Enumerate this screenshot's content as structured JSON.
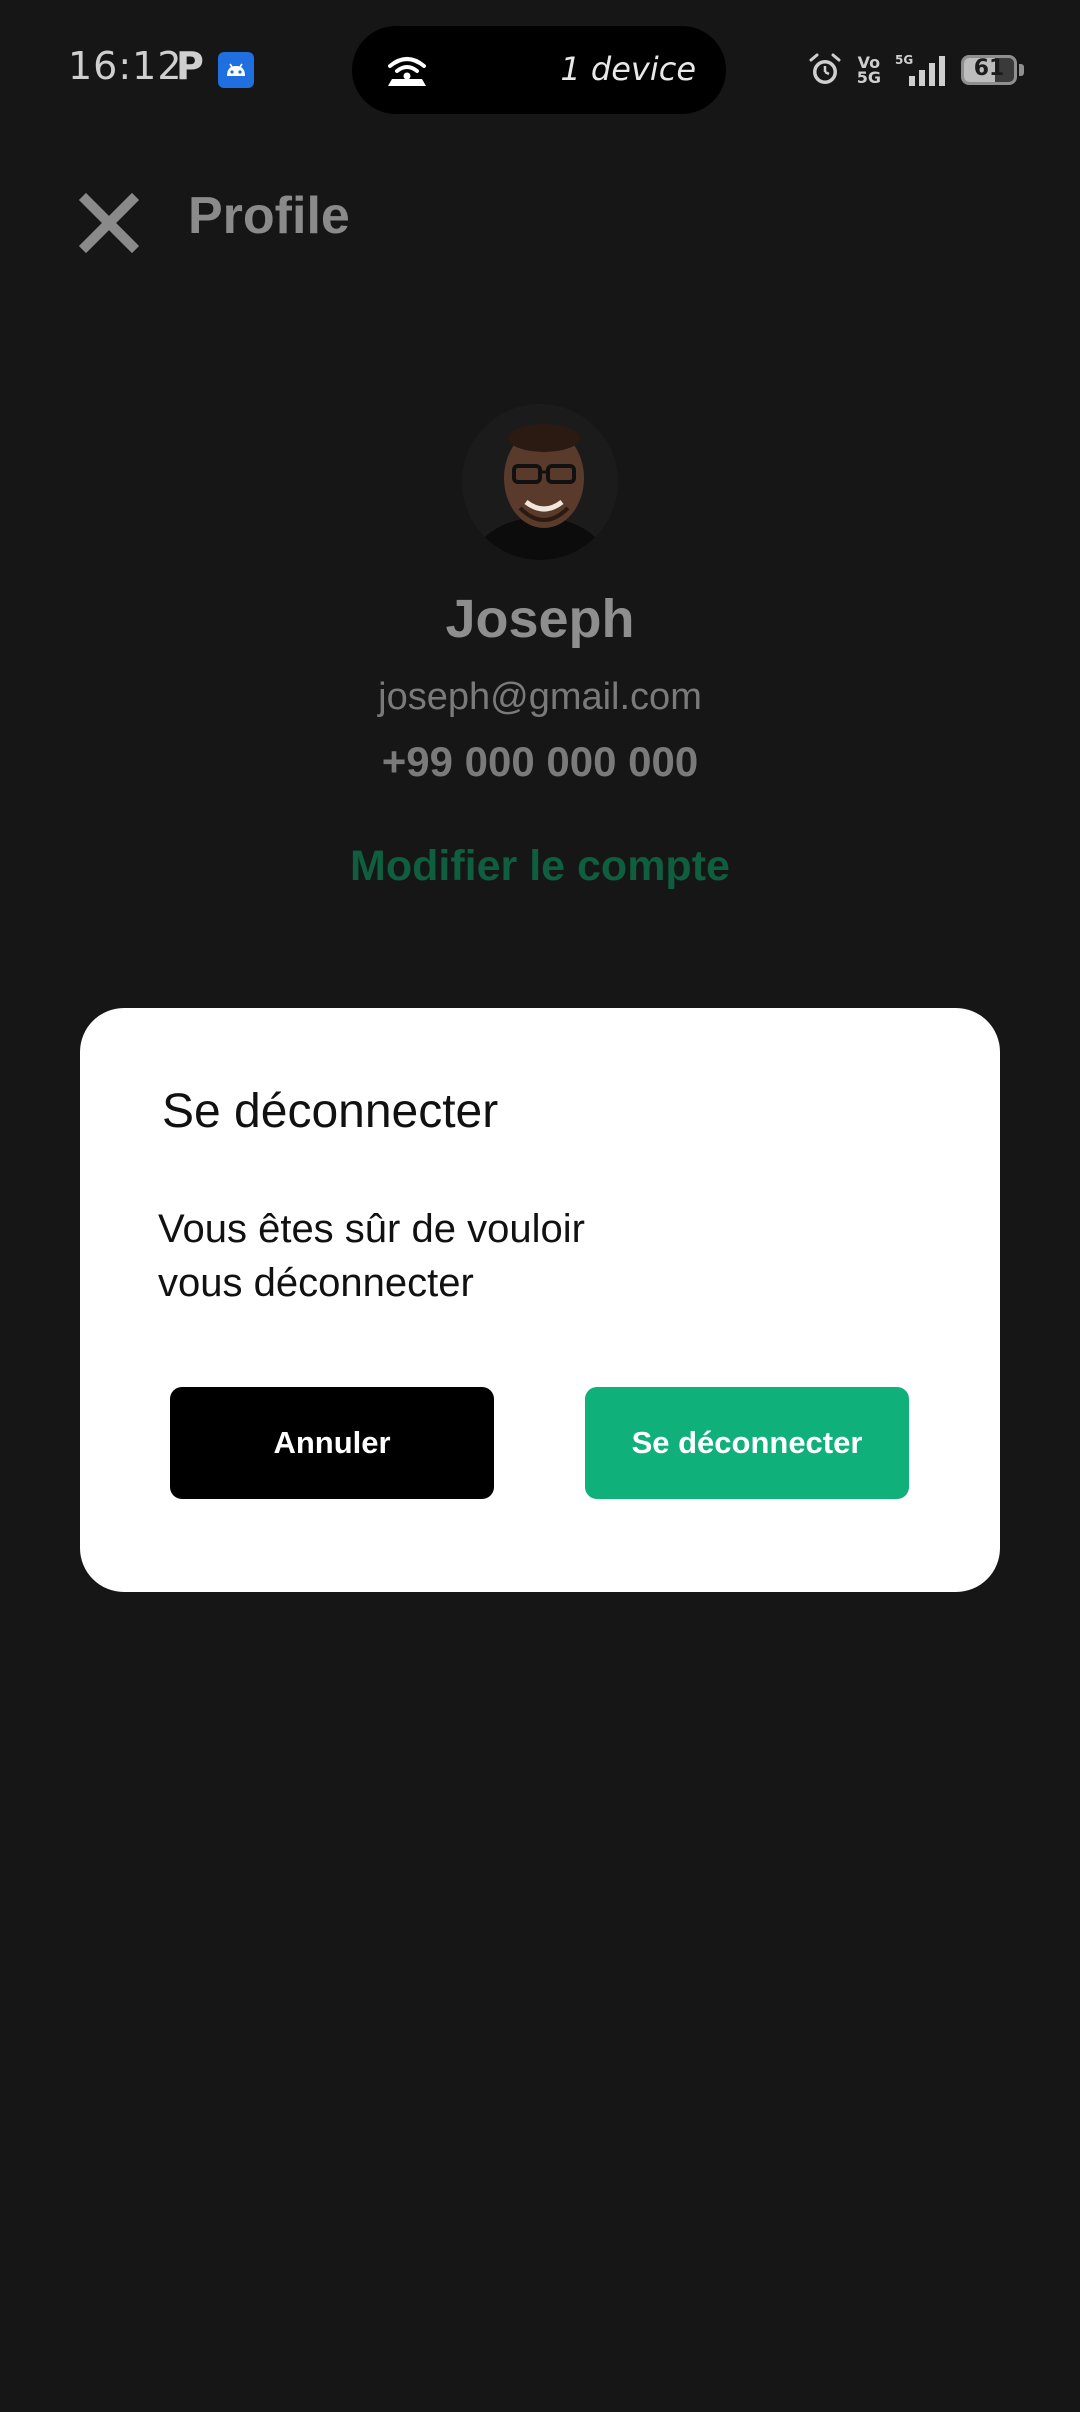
{
  "status_bar": {
    "time": "16:12",
    "p_indicator": "P",
    "hotspot_text": "1 device",
    "volte_label": "Vo\n5G",
    "network_label": "5G",
    "battery": "61",
    "battery_level": 0.61
  },
  "header": {
    "title": "Profile"
  },
  "profile": {
    "name": "Joseph",
    "email": "joseph@gmail.com",
    "phone": "+99 000 000 000",
    "edit_label": "Modifier le compte"
  },
  "dialog": {
    "title": "Se déconnecter",
    "message": "Vous êtes sûr de vouloir vous déconnecter",
    "cancel_label": "Annuler",
    "confirm_label": "Se déconnecter"
  },
  "colors": {
    "background": "#161616",
    "accent_green": "#10b07b",
    "edit_link_dimmed": "#0e5e3f",
    "dialog_bg": "#ffffff",
    "cancel_bg": "#000000"
  },
  "icons": {
    "close": "close-icon",
    "hotspot": "hotspot-icon",
    "alarm": "alarm-icon",
    "signal": "signal-icon",
    "android": "android-icon"
  }
}
